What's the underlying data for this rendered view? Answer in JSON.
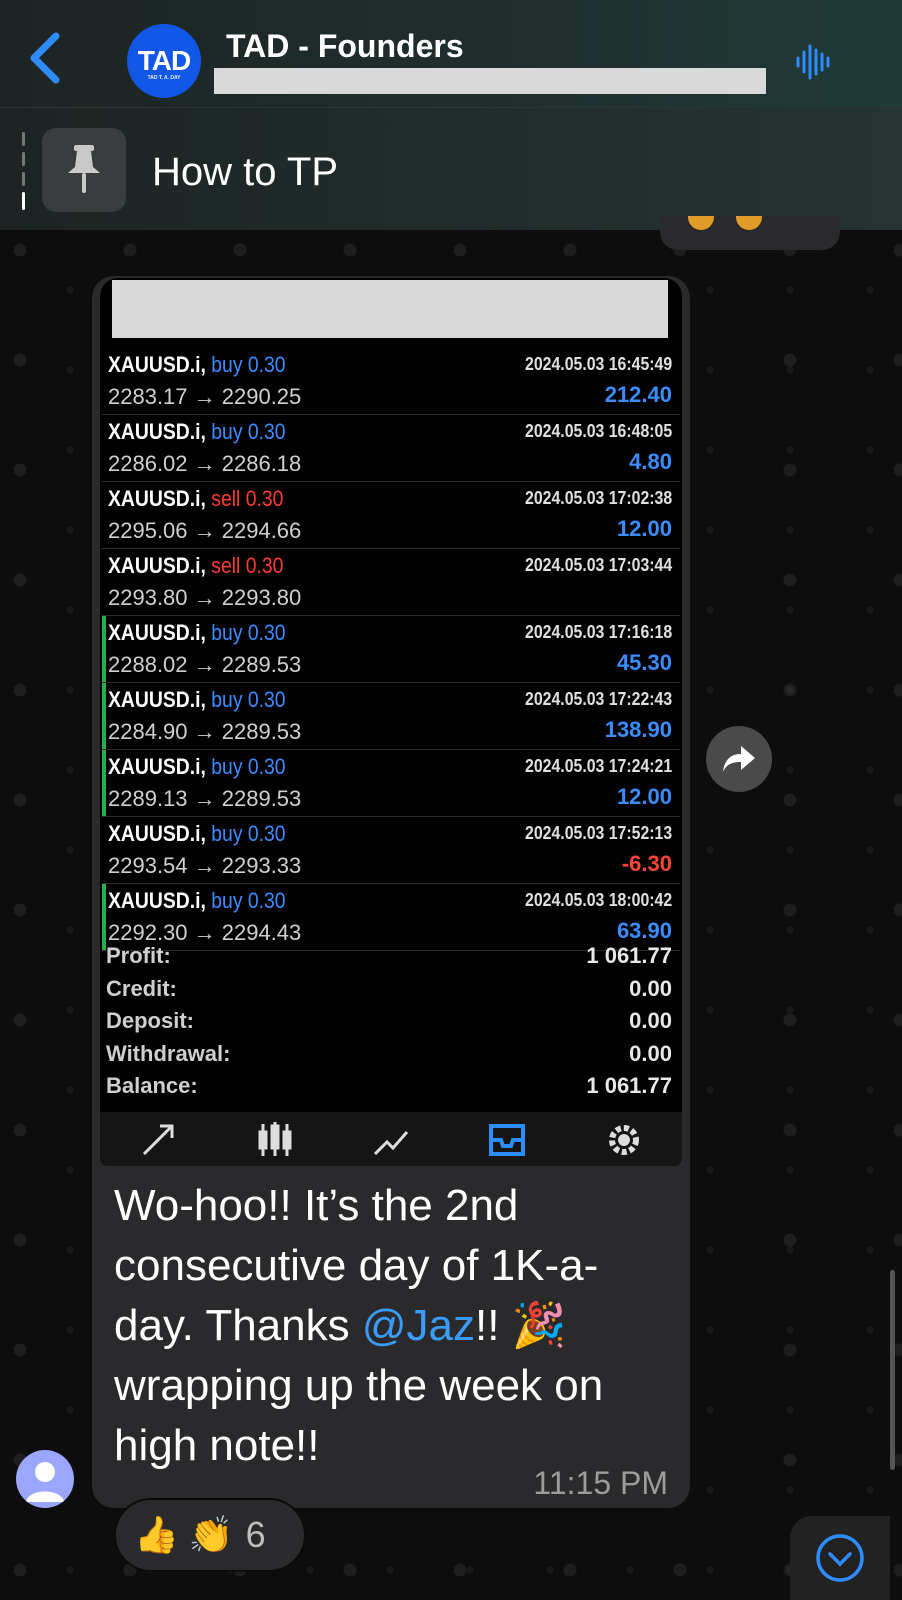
{
  "header": {
    "title": "TAD - Founders",
    "avatar_text": "TAD",
    "avatar_subtext": "TAD T. A. DAY"
  },
  "pinned": {
    "text": "How to TP"
  },
  "trades": [
    {
      "symbol": "XAUUSD.i,",
      "direction": "buy",
      "volume": "buy 0.30",
      "prices": "2283.17 → 2290.25",
      "time": "2024.05.03 16:45:49",
      "pl": "212.40",
      "marked": false
    },
    {
      "symbol": "XAUUSD.i,",
      "direction": "buy",
      "volume": "buy 0.30",
      "prices": "2286.02 → 2286.18",
      "time": "2024.05.03 16:48:05",
      "pl": "4.80",
      "marked": false
    },
    {
      "symbol": "XAUUSD.i,",
      "direction": "sell",
      "volume": "sell 0.30",
      "prices": "2295.06 → 2294.66",
      "time": "2024.05.03 17:02:38",
      "pl": "12.00",
      "marked": false
    },
    {
      "symbol": "XAUUSD.i,",
      "direction": "sell",
      "volume": "sell 0.30",
      "prices": "2293.80 → 2293.80",
      "time": "2024.05.03 17:03:44",
      "pl": "",
      "marked": false
    },
    {
      "symbol": "XAUUSD.i,",
      "direction": "buy",
      "volume": "buy 0.30",
      "prices": "2288.02 → 2289.53",
      "time": "2024.05.03 17:16:18",
      "pl": "45.30",
      "marked": true
    },
    {
      "symbol": "XAUUSD.i,",
      "direction": "buy",
      "volume": "buy 0.30",
      "prices": "2284.90 → 2289.53",
      "time": "2024.05.03 17:22:43",
      "pl": "138.90",
      "marked": true
    },
    {
      "symbol": "XAUUSD.i,",
      "direction": "buy",
      "volume": "buy 0.30",
      "prices": "2289.13 → 2289.53",
      "time": "2024.05.03 17:24:21",
      "pl": "12.00",
      "marked": true
    },
    {
      "symbol": "XAUUSD.i,",
      "direction": "buy",
      "volume": "buy 0.30",
      "prices": "2293.54 → 2293.33",
      "time": "2024.05.03 17:52:13",
      "pl": "-6.30",
      "marked": false
    },
    {
      "symbol": "XAUUSD.i,",
      "direction": "buy",
      "volume": "buy 0.30",
      "prices": "2292.30 → 2294.43",
      "time": "2024.05.03 18:00:42",
      "pl": "63.90",
      "marked": true
    }
  ],
  "summary": [
    {
      "label": "Profit:",
      "value": "1 061.77"
    },
    {
      "label": "Credit:",
      "value": "0.00"
    },
    {
      "label": "Deposit:",
      "value": "0.00"
    },
    {
      "label": "Withdrawal:",
      "value": "0.00"
    },
    {
      "label": "Balance:",
      "value": "1 061.77"
    }
  ],
  "message": {
    "text_before": "Wo-hoo!! It’s the 2nd consecutive day of 1K-a-day. Thanks ",
    "mention": "@Jaz",
    "text_after": "!! 🎉 wrapping up the week on high note!!",
    "time": "11:15 PM"
  },
  "reactions": {
    "emojis": "👍 👏",
    "count": "6"
  },
  "colors": {
    "buy": "#3b8dff",
    "sell": "#ff3b30",
    "mention": "#3b9cff",
    "accent_green": "#22b14c",
    "avatar_blue": "#1257e8"
  },
  "icons": [
    "back-chevron-icon",
    "voice-chat-icon",
    "pin-icon",
    "forward-icon",
    "user-avatar-icon",
    "scroll-down-icon"
  ]
}
